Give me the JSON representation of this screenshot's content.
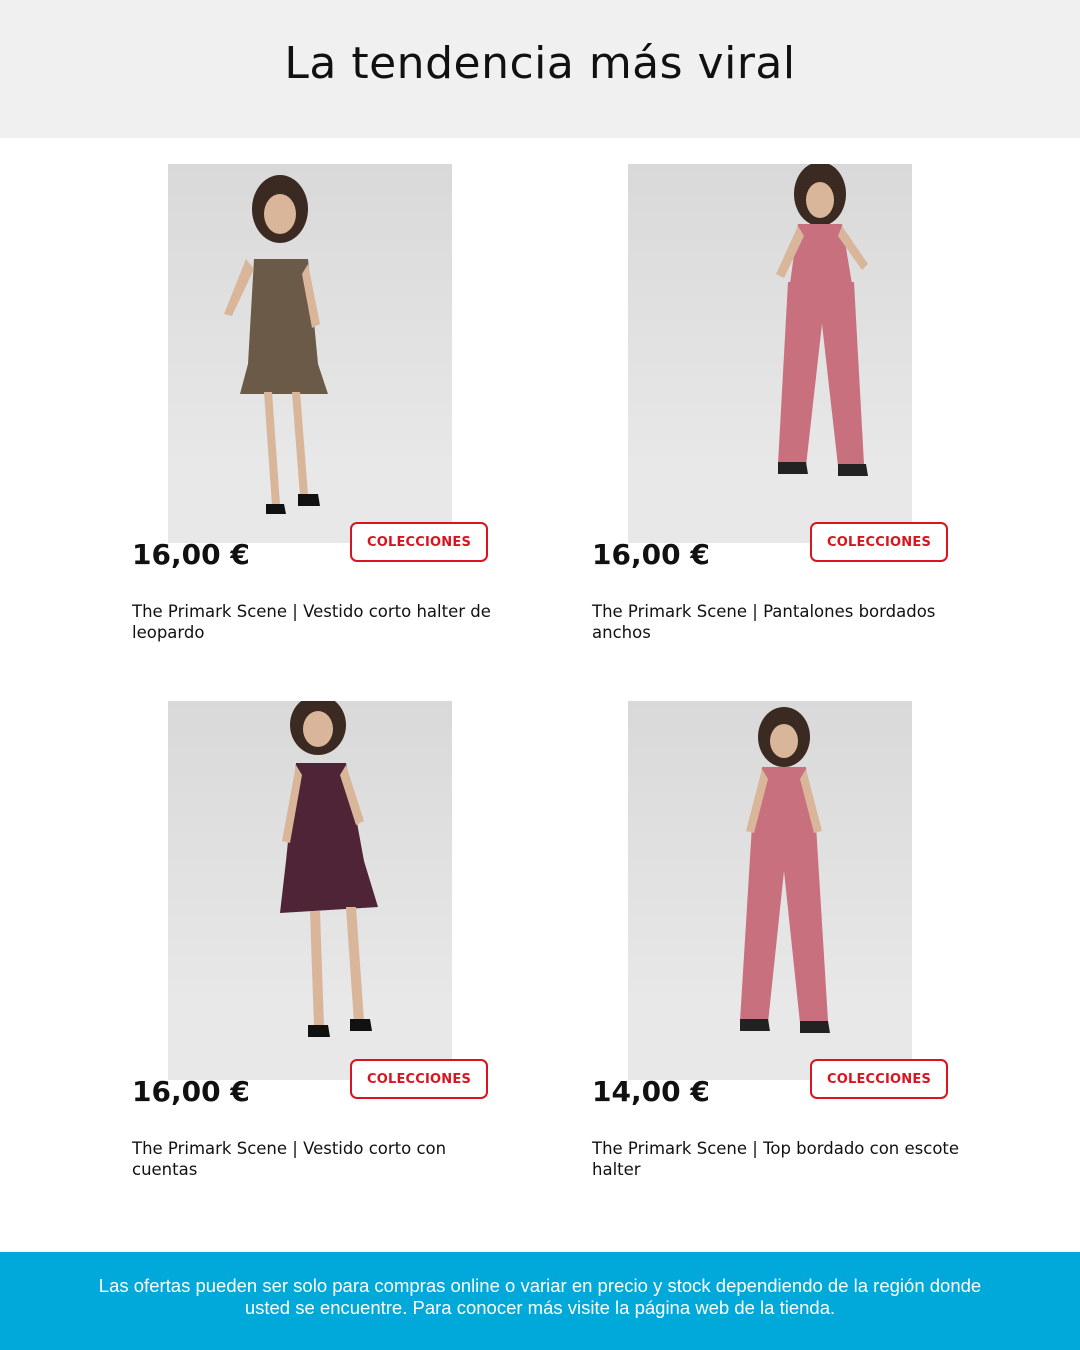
{
  "header": {
    "title": "La tendencia más viral"
  },
  "products": [
    {
      "price": "16,00 €",
      "button_label": "COLECCIONES",
      "title": "The Primark Scene | Vestido corto halter de leopardo",
      "garment_color": "#6b5a48",
      "garment_type": "dress"
    },
    {
      "price": "16,00 €",
      "button_label": "COLECCIONES",
      "title": "The Primark Scene | Pantalones bordados anchos",
      "garment_color": "#c9707f",
      "garment_type": "jumpsuit"
    },
    {
      "price": "16,00 €",
      "button_label": "COLECCIONES",
      "title": "The Primark Scene | Vestido corto con cuentas",
      "garment_color": "#4e2436",
      "garment_type": "dress"
    },
    {
      "price": "14,00 €",
      "button_label": "COLECCIONES",
      "title": "The Primark Scene | Top bordado con escote halter",
      "garment_color": "#c9707f",
      "garment_type": "jumpsuit"
    }
  ],
  "footer": {
    "disclaimer": "Las ofertas pueden ser solo para compras online o variar en precio y stock dependiendo de la región donde usted se encuentre. Para conocer más visite la página web de la tienda."
  },
  "colors": {
    "accent_red": "#d9141e",
    "footer_blue": "#00a9d9",
    "header_gray": "#f0f0f0"
  }
}
